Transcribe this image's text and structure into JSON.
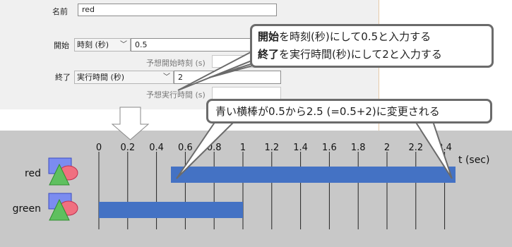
{
  "form": {
    "name_label": "名前",
    "name_value": "red",
    "start_label": "開始",
    "start_mode": "時刻 (秒)",
    "start_value": "0.5",
    "start_hint": "予想開始時刻 (s)",
    "end_label": "終了",
    "end_mode": "実行時間 (秒)",
    "end_value": "2",
    "end_hint": "予想実行時間 (s)"
  },
  "callouts": {
    "line1_bold": "開始",
    "line1_rest": "を時刻(秒)にして0.5と入力する",
    "line2_bold": "終了",
    "line2_rest": "を実行時間(秒)にして2と入力する",
    "bar_note": "青い横棒が0.5から2.5 (=0.5+2)に変更される"
  },
  "timeline": {
    "axis_unit": "t (sec)",
    "ticks": [
      "0",
      "0.2",
      "0.4",
      "0.6",
      "0.8",
      "1",
      "1.2",
      "1.4",
      "1.6",
      "1.8",
      "2",
      "2.2",
      "2.4"
    ],
    "rows": [
      {
        "label": "red",
        "start": 0.5,
        "end": 2.5
      },
      {
        "label": "green",
        "start": 0.0,
        "end": 1.0
      }
    ],
    "bar_color": "#4472c4"
  }
}
